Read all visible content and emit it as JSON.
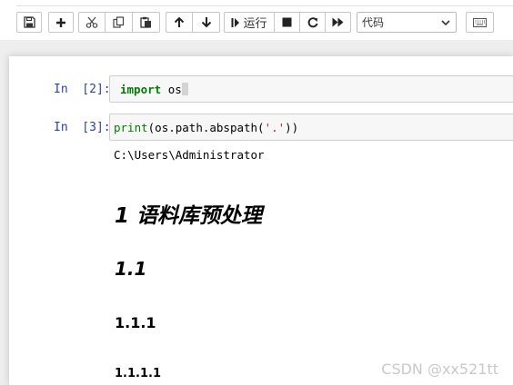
{
  "toolbar": {
    "run_label": "运行",
    "cell_type_selected": "代码"
  },
  "cells": [
    {
      "prompt": "In  [2]:",
      "code": {
        "keyword": "import",
        "module": "os"
      }
    },
    {
      "prompt": "In  [3]:",
      "code": {
        "fn": "print",
        "open": "(os.path.abspath(",
        "str": "'.'",
        "close": "))"
      },
      "output": "C:\\Users\\Administrator"
    }
  ],
  "headings": {
    "h1": "1 语料库预处理",
    "h2": "1.1",
    "h3": "1.1.1",
    "h4": "1.1.1.1"
  },
  "watermark": "CSDN @xx521tt"
}
